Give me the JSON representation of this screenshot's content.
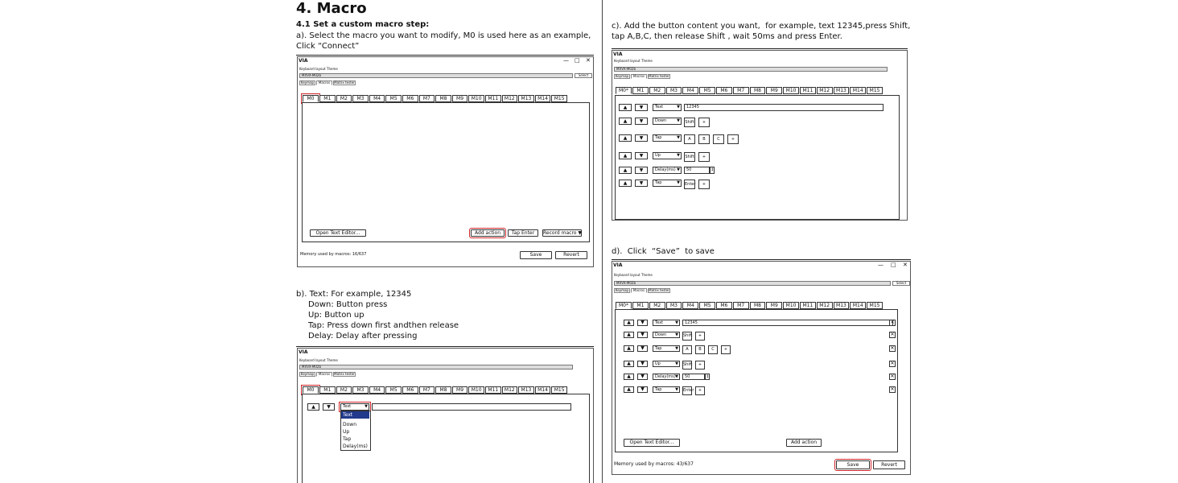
{
  "page_title": "4. Macro",
  "section_41": "4.1 Set a custom macro step:",
  "step_a": {
    "line1": "a). Select the macro you want to modify, M0 is used here as an example,",
    "line2": "Click “Connect”"
  },
  "step_b": {
    "line1": "b). Text: For example, 12345",
    "line2": "Down: Button press",
    "line3": "Up: Button up",
    "line4": "Tap: Press down first andthen release",
    "line5": "Delay: Delay after pressing"
  },
  "step_c": {
    "line1": "c). Add the button content you want,  for example, text 12345,press Shift,",
    "line2": "tap A,B,C, then release Shift , wait 50ms and press Enter."
  },
  "step_d": {
    "line1": "d).  Click  “Save”  to save"
  },
  "app": {
    "logo": "🎮",
    "brand": "VIA",
    "menu_keyboard": "Keyboard layout",
    "menu_theme": "Theme",
    "device": "MXVX-M02b",
    "select_label": "Select",
    "tab_keymap": "Keymap",
    "tab_macros": "Macros",
    "tab_matrix": "Matrix tester",
    "win_min": "—",
    "win_max": "□",
    "win_close": "✕"
  },
  "macro_tabs": [
    "M0",
    "M1",
    "M2",
    "M3",
    "M4",
    "M5",
    "M6",
    "M7",
    "M8",
    "M9",
    "M10",
    "M11",
    "M12",
    "M13",
    "M14",
    "M15"
  ],
  "macro_tab_dirty": "M0*",
  "buttons": {
    "open_text_editor": "Open Text Editor...",
    "add_action": "Add action",
    "tap_enter": "Tap Enter",
    "record_macro": "Record macro ▼",
    "save": "Save",
    "revert": "Revert"
  },
  "memory_a": "Memory used by macros: 16/637",
  "memory_d": "Memory used by macros: 43/637",
  "arrow_up": "▲",
  "arrow_down": "▼",
  "dropdown": {
    "current": "Text",
    "options": [
      "Text",
      "Down",
      "Up",
      "Tap",
      "Delay(ms)"
    ]
  },
  "actions": [
    {
      "type": "Text",
      "value": "12345",
      "keys": []
    },
    {
      "type": "Down",
      "value": "",
      "keys": [
        "Shift"
      ]
    },
    {
      "type": "Tap",
      "value": "",
      "keys": [
        "A",
        "B",
        "C"
      ]
    },
    {
      "type": "Up",
      "value": "",
      "keys": [
        "Shift"
      ]
    },
    {
      "type": "Delay(ms)",
      "value": "50",
      "keys": []
    },
    {
      "type": "Tap",
      "value": "",
      "keys": [
        "Enter"
      ]
    }
  ],
  "plus": "+",
  "remove": "✕",
  "spin": "↕"
}
